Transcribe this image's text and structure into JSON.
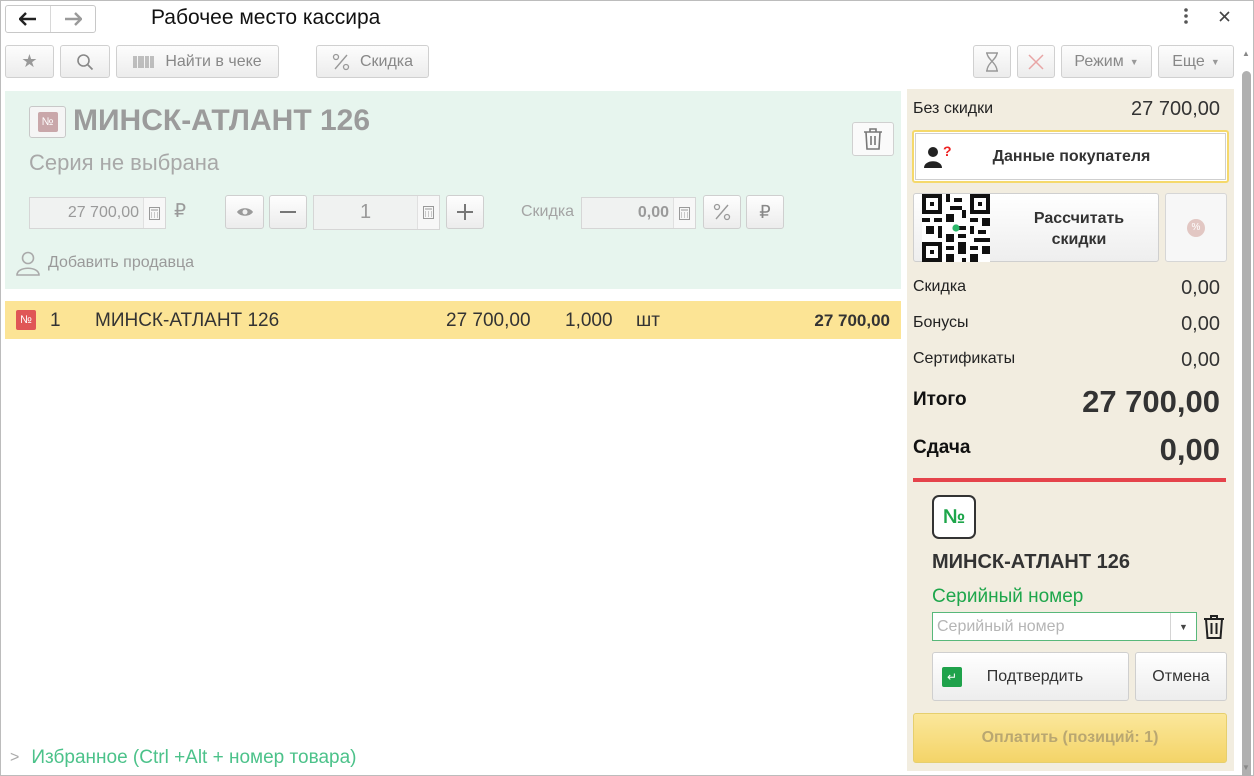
{
  "window": {
    "title": "Рабочее место кассира"
  },
  "toolbar": {
    "find_in_receipt": "Найти в чеке",
    "discount": "Скидка",
    "mode": "Режим",
    "more": "Еще"
  },
  "item_card": {
    "badge": "№",
    "name": "МИНСК-АТЛАНТ 126",
    "series_status": "Серия не выбрана",
    "price": "27 700,00",
    "currency": "₽",
    "quantity": "1",
    "discount_label": "Скидка",
    "discount_value": "0,00",
    "add_seller": "Добавить продавца"
  },
  "receipt": {
    "rows": [
      {
        "badge": "№",
        "num": "1",
        "name": "МИНСК-АТЛАНТ 126",
        "price": "27 700,00",
        "qty": "1,000",
        "unit": "шт",
        "sum": "27 700,00"
      }
    ]
  },
  "favorites": {
    "label": "Избранное (Ctrl +Alt + номер товара)"
  },
  "summary": {
    "no_discount_label": "Без скидки",
    "no_discount_value": "27 700,00",
    "customer_button": "Данные покупателя",
    "calc_discount_button_line1": "Рассчитать",
    "calc_discount_button_line2": "скидки",
    "discount_label": "Скидка",
    "discount_value": "0,00",
    "bonuses_label": "Бонусы",
    "bonuses_value": "0,00",
    "certificates_label": "Сертификаты",
    "certificates_value": "0,00",
    "total_label": "Итого",
    "total_value": "27 700,00",
    "change_label": "Сдача",
    "change_value": "0,00"
  },
  "serial_panel": {
    "badge": "№",
    "product_name": "МИНСК-АТЛАНТ 126",
    "serial_label": "Серийный номер",
    "serial_placeholder": "Серийный номер",
    "serial_value": "",
    "confirm": "Подтвердить",
    "cancel": "Отмена"
  },
  "pay_button": "Оплатить (позиций: 1)",
  "colors": {
    "accent_green": "#1ea64b",
    "row_highlight": "#fce495",
    "card_bg": "#e7f5ee",
    "alert_red": "#e5434b"
  }
}
